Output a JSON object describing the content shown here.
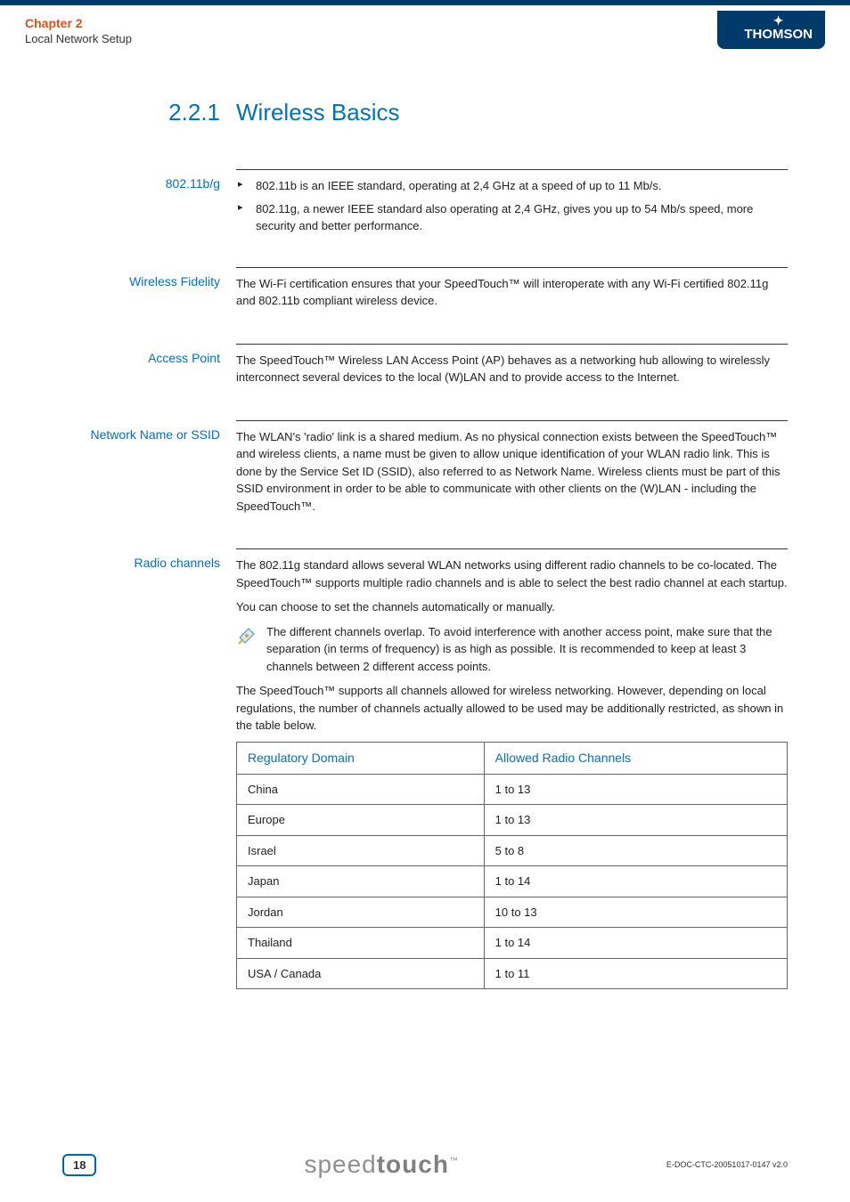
{
  "chapter": {
    "title": "Chapter 2",
    "subtitle": "Local Network Setup"
  },
  "brand_header": "THOMSON",
  "section": {
    "number": "2.2.1",
    "title": "Wireless Basics"
  },
  "blocks": {
    "std": {
      "label": "802.11b/g",
      "bullets": [
        "802.11b is an IEEE standard, operating at 2,4 GHz at a speed of up to 11 Mb/s.",
        "802.11g, a newer IEEE standard also operating at 2,4 GHz, gives you up to 54 Mb/s speed, more security and better performance."
      ]
    },
    "wifi": {
      "label": "Wireless Fidelity",
      "text": "The Wi-Fi certification ensures that your SpeedTouch™ will interoperate with any Wi-Fi certified 802.11g and 802.11b compliant wireless device."
    },
    "ap": {
      "label": "Access Point",
      "text": "The SpeedTouch™ Wireless LAN Access Point (AP) behaves as a networking hub allowing to wirelessly interconnect several devices to the local (W)LAN and to provide access to the Internet."
    },
    "ssid": {
      "label": "Network Name or SSID",
      "text": "The WLAN's 'radio' link is a shared medium. As no physical connection exists between the SpeedTouch™ and wireless clients, a name must be given to allow unique identification of your WLAN radio link. This is done by the Service Set ID (SSID), also referred to as Network Name. Wireless clients must be part of this SSID environment in order to be able to communicate with other clients on the (W)LAN - including the SpeedTouch™."
    },
    "radio": {
      "label": "Radio channels",
      "p1": "The 802.11g standard allows several WLAN networks using different radio channels to be co-located. The SpeedTouch™ supports multiple radio channels and is able to select the best radio channel at each startup.",
      "p2": "You can choose to set the channels automatically or manually.",
      "note": "The different channels overlap. To avoid interference with another access point, make sure that the separation (in terms of frequency) is as high as possible. It is recommended to keep at least 3 channels between 2 different access points.",
      "p3": "The SpeedTouch™ supports all channels allowed for wireless networking. However, depending on local regulations, the number of channels actually allowed to be used may be additionally restricted, as shown in the table below."
    }
  },
  "table": {
    "headers": [
      "Regulatory Domain",
      "Allowed Radio Channels"
    ],
    "rows": [
      [
        "China",
        "1 to 13"
      ],
      [
        "Europe",
        "1 to 13"
      ],
      [
        "Israel",
        "5 to 8"
      ],
      [
        "Japan",
        "1 to 14"
      ],
      [
        "Jordan",
        "10 to 13"
      ],
      [
        "Thailand",
        "1 to 14"
      ],
      [
        "USA / Canada",
        "1 to 11"
      ]
    ]
  },
  "footer": {
    "page": "18",
    "brand_light": "speed",
    "brand_bold": "touch",
    "tm": "™",
    "doc_id": "E-DOC-CTC-20051017-0147 v2.0"
  }
}
